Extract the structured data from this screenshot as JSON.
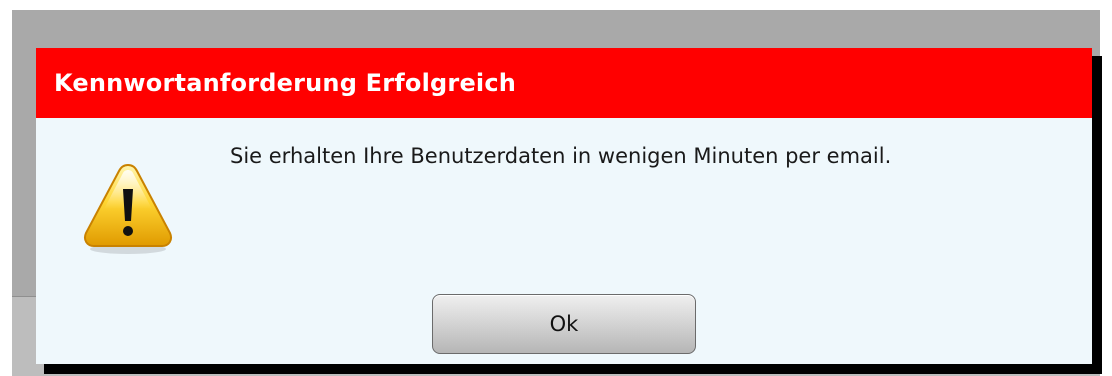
{
  "dialog": {
    "title": "Kennwortanforderung Erfolgreich",
    "message": "Sie erhalten Ihre Benutzerdaten in wenigen Minuten per email.",
    "ok_label": "Ok",
    "icon": "warning-icon"
  },
  "colors": {
    "titlebar": "#ff0000",
    "title_text": "#ffffff",
    "dialog_body": "#eff8fc",
    "backdrop": "#a9a9a9"
  }
}
